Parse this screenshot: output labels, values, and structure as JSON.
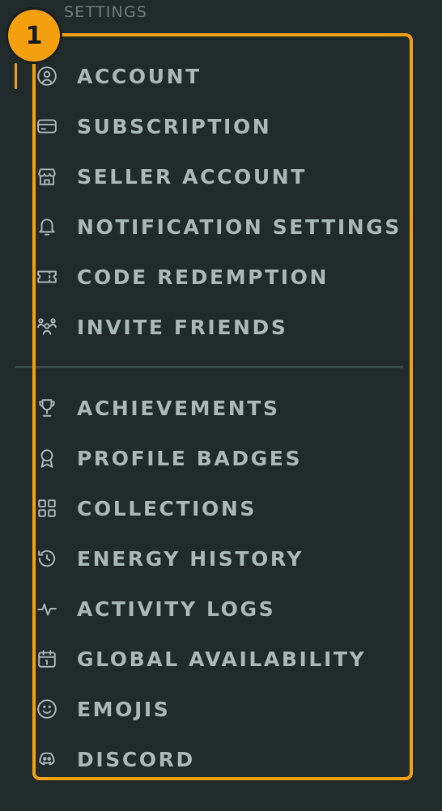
{
  "settings": {
    "title": "SETTINGS",
    "step_number": "1",
    "accent_color": "#f5a00e",
    "text_color": "#aab8b8",
    "group1": [
      {
        "label": "ACCOUNT",
        "icon": "user-circle-icon",
        "active": true
      },
      {
        "label": "SUBSCRIPTION",
        "icon": "credit-card-icon"
      },
      {
        "label": "SELLER ACCOUNT",
        "icon": "store-icon"
      },
      {
        "label": "NOTIFICATION SETTINGS",
        "icon": "bell-icon"
      },
      {
        "label": "CODE REDEMPTION",
        "icon": "ticket-icon"
      },
      {
        "label": "INVITE FRIENDS",
        "icon": "users-icon"
      }
    ],
    "group2": [
      {
        "label": "ACHIEVEMENTS",
        "icon": "trophy-icon"
      },
      {
        "label": "PROFILE BADGES",
        "icon": "award-icon"
      },
      {
        "label": "COLLECTIONS",
        "icon": "grid-icon"
      },
      {
        "label": "ENERGY HISTORY",
        "icon": "history-icon"
      },
      {
        "label": "ACTIVITY LOGS",
        "icon": "activity-icon"
      },
      {
        "label": "GLOBAL AVAILABILITY",
        "icon": "calendar-icon"
      },
      {
        "label": "EMOJIS",
        "icon": "smile-icon"
      },
      {
        "label": "DISCORD",
        "icon": "discord-icon"
      }
    ]
  }
}
